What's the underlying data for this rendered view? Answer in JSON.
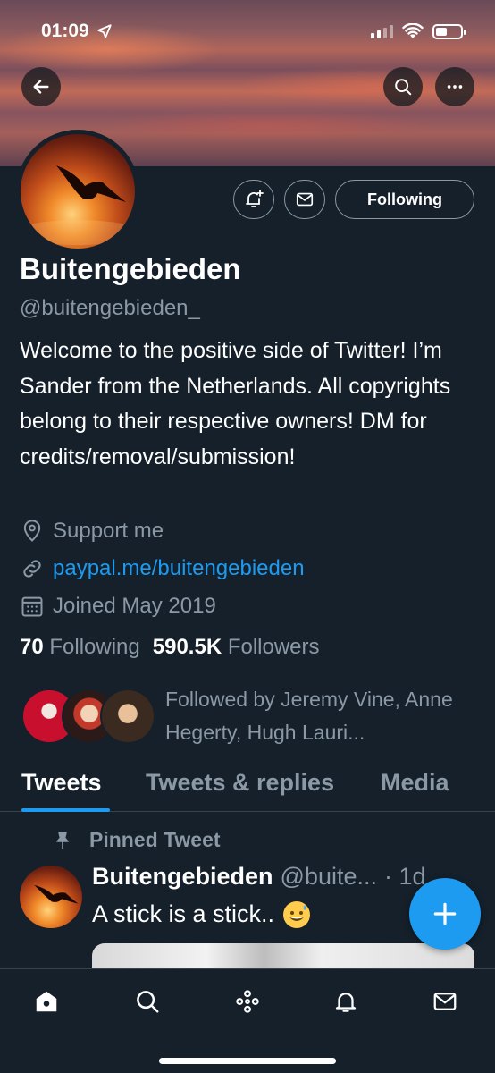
{
  "status_bar": {
    "time": "01:09"
  },
  "profile": {
    "follow_button_label": "Following",
    "name": "Buitengebieden",
    "handle": "@buitengebieden_",
    "bio": "Welcome to the positive side of Twitter! I’m Sander from the Netherlands. All copyrights belong to their respective owners! DM for credits/removal/submission!",
    "location": "Support me",
    "website": "paypal.me/buitengebieden",
    "joined": "Joined May 2019",
    "following_count": "70",
    "following_label": "Following",
    "followers_count": "590.5K",
    "followers_label": "Followers",
    "followed_by_text": "Followed by Jeremy Vine, Anne Hegerty, Hugh Lauri..."
  },
  "tabs": [
    {
      "label": "Tweets",
      "active": true
    },
    {
      "label": "Tweets & replies",
      "active": false
    },
    {
      "label": "Media",
      "active": false
    }
  ],
  "pinned_tweet": {
    "pinned_label": "Pinned Tweet",
    "author_name": "Buitengebieden",
    "author_handle": "@buite...",
    "time": "· 1d",
    "text": "A stick is a stick.."
  },
  "icons": {
    "back": "arrow-left-icon",
    "search": "search-icon",
    "more": "more-horizontal-icon",
    "notify": "bell-plus-icon",
    "message": "envelope-icon",
    "location": "location-pin-icon",
    "link": "link-icon",
    "calendar": "calendar-icon",
    "pin": "pin-icon",
    "compose": "plus-icon",
    "nav": [
      "home-icon",
      "search-icon",
      "spaces-icon",
      "bell-icon",
      "envelope-icon"
    ]
  },
  "colors": {
    "background": "#15202b",
    "accent": "#1d9bf0",
    "muted": "#8b98a5"
  }
}
